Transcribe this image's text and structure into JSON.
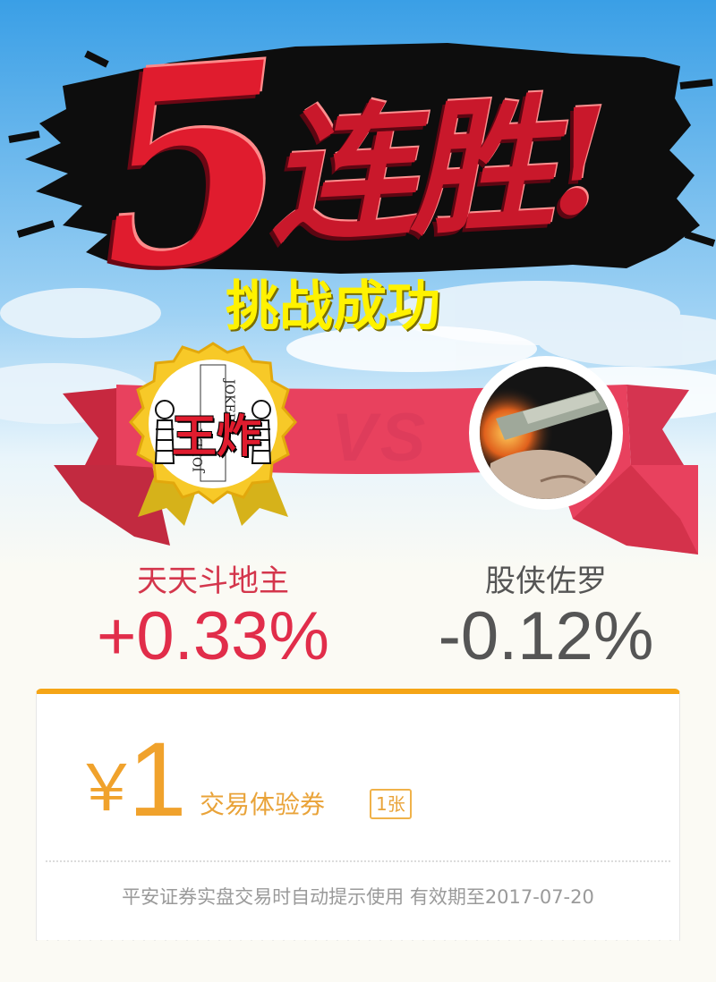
{
  "header": {
    "streak_number": "5",
    "streak_text": "连胜!",
    "subtitle": "挑战成功",
    "vs": "VS"
  },
  "player_left": {
    "badge_text": "王炸",
    "card_text": "JOKER",
    "name": "天天斗地主",
    "change": "+0.33%"
  },
  "player_right": {
    "name": "股侠佐罗",
    "change": "-0.12%"
  },
  "coupon": {
    "currency": "￥",
    "amount": "1",
    "name": "交易体验券",
    "count": "1张",
    "note": "平安证券实盘交易时自动提示使用 有效期至2017-07-20"
  },
  "colors": {
    "accent_red": "#e12d4a",
    "gold": "#f5a516",
    "sky_top": "#3a9fe6",
    "ribbon": "#e8415e",
    "loss_gray": "#555555"
  },
  "icons": [
    "joker-card-avatar",
    "cigarette-avatar"
  ]
}
